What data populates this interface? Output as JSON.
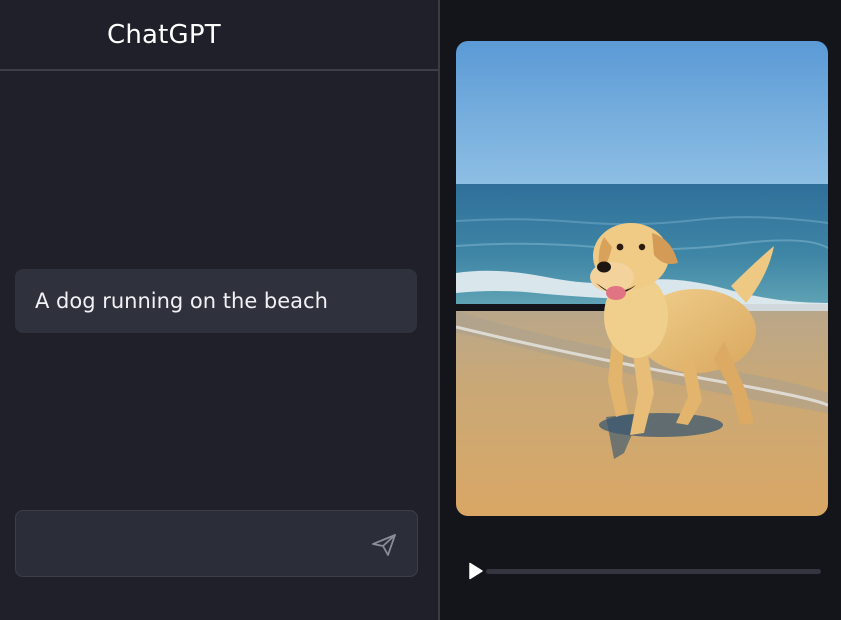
{
  "header": {
    "title": "ChatGPT"
  },
  "conversation": {
    "messages": [
      {
        "role": "user",
        "text": "A dog running on the beach"
      }
    ]
  },
  "composer": {
    "value": "",
    "placeholder": "",
    "send_icon": "send-icon"
  },
  "media": {
    "type": "video",
    "subject": "golden retriever on a sandy beach",
    "play_icon": "play-icon",
    "progress": 0
  },
  "colors": {
    "chat_bg": "#1f2029",
    "bubble_bg": "#2f313d",
    "composer_bg": "#2b2d38",
    "media_bg": "#13151b",
    "text": "#ffffff"
  }
}
